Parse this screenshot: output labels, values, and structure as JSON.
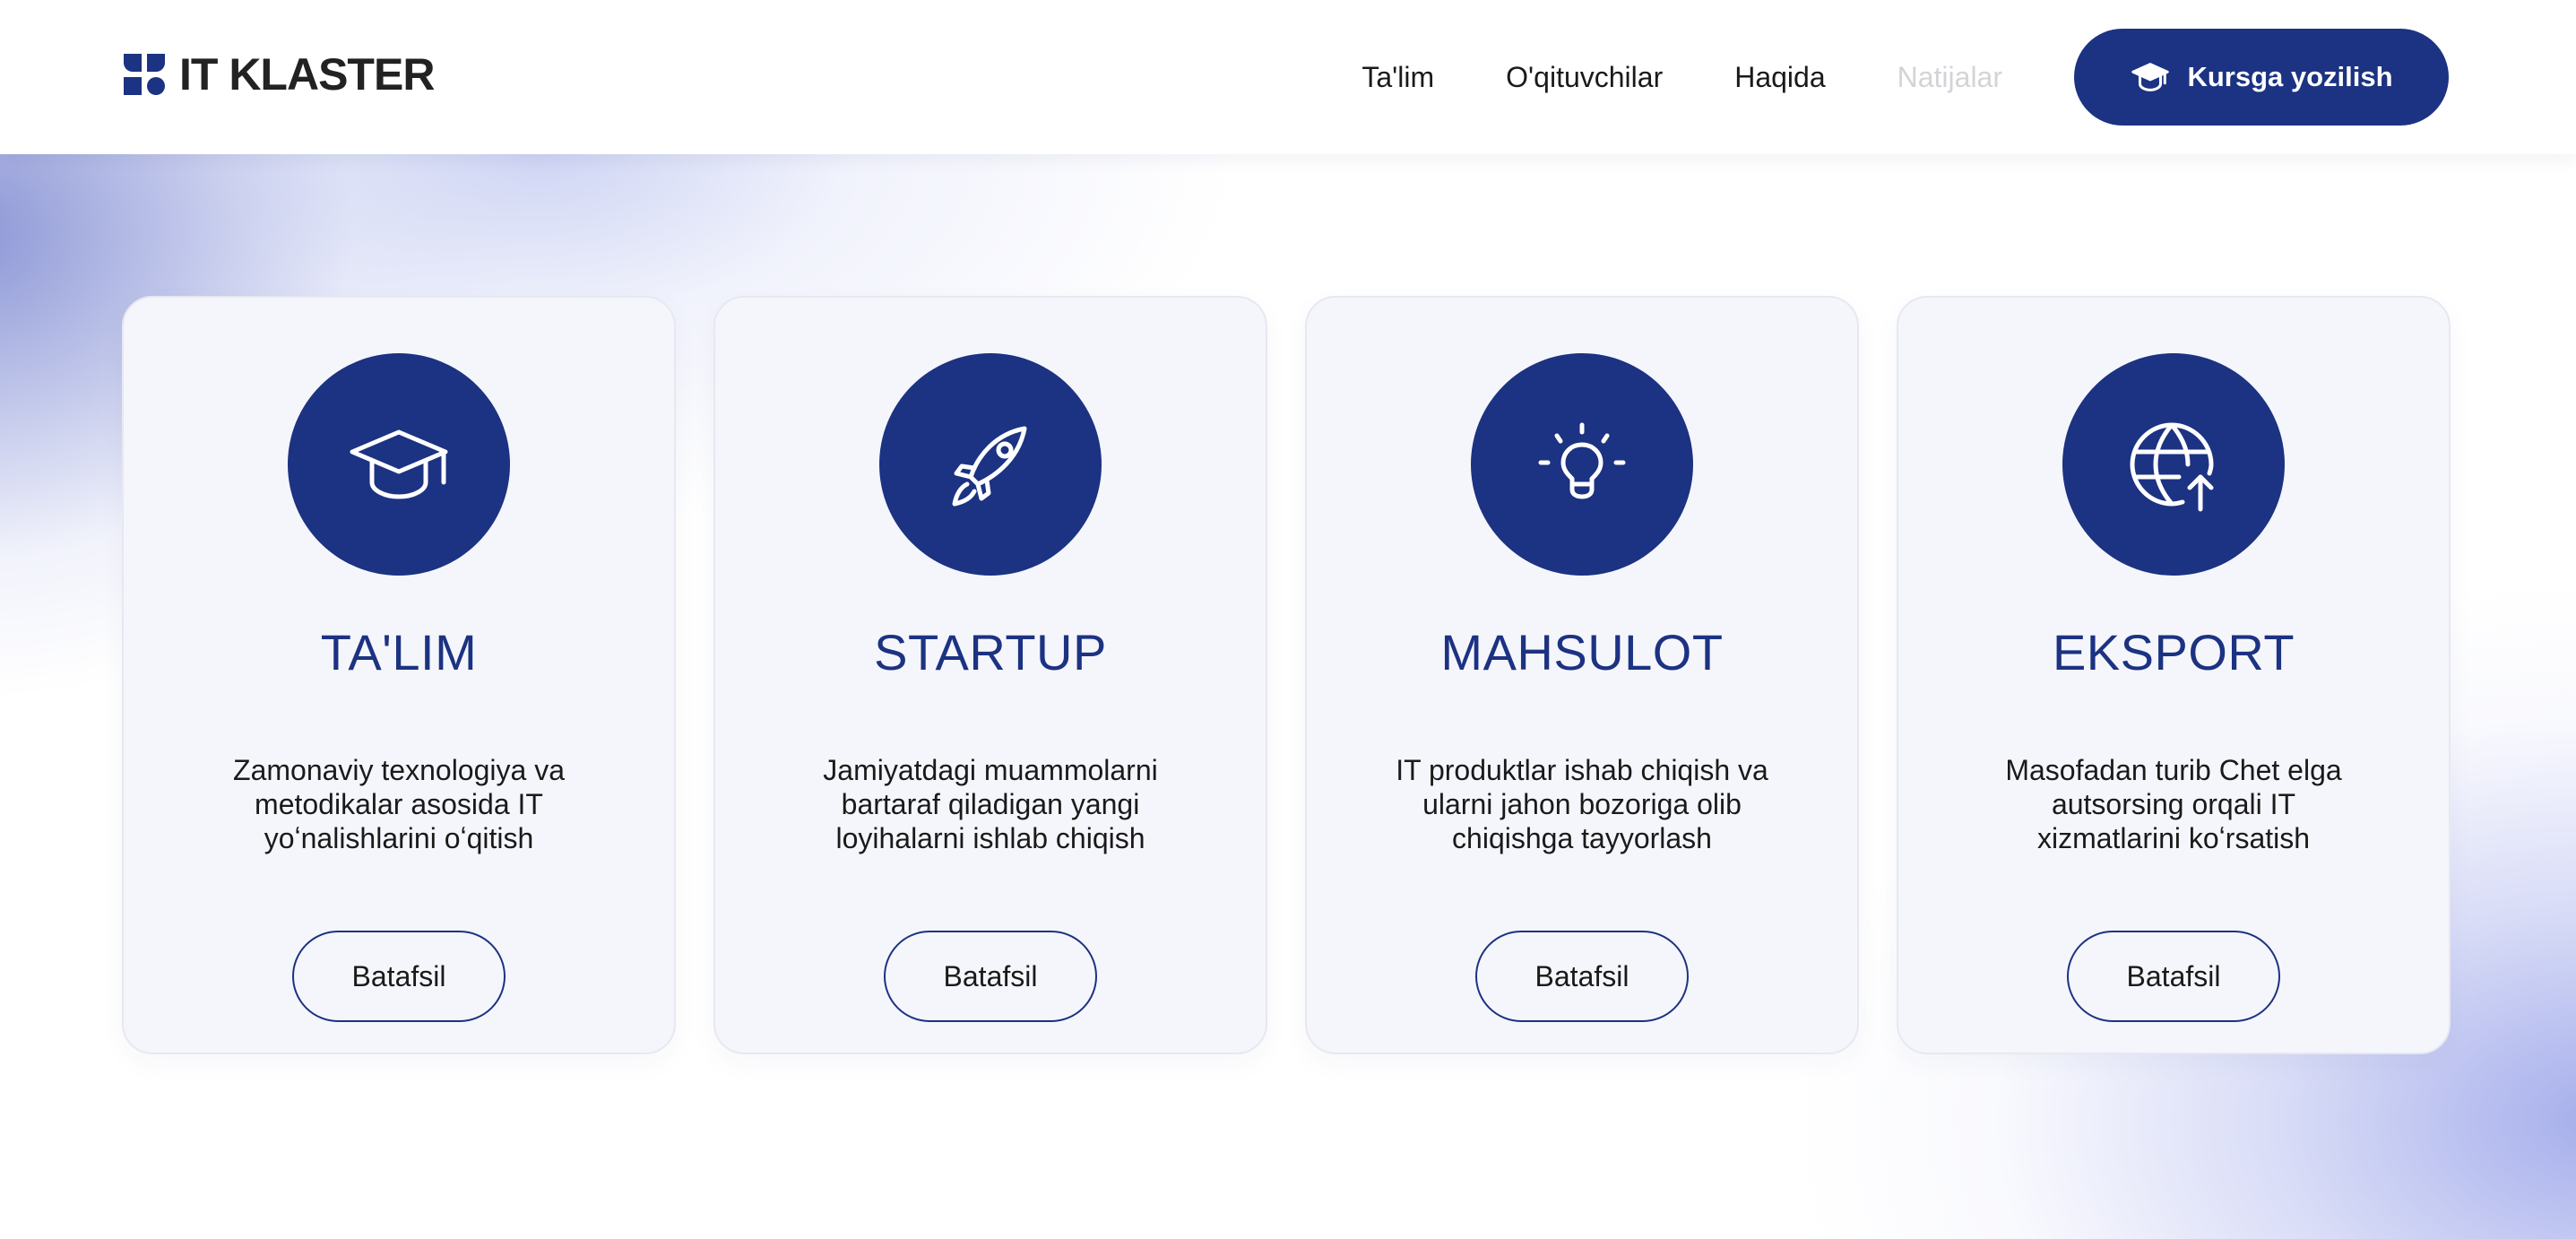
{
  "brand": {
    "name": "IT KLASTER",
    "accent_color": "#1c3282"
  },
  "header": {
    "nav": [
      {
        "label": "Ta'lim",
        "state": "normal"
      },
      {
        "label": "O'qituvchilar",
        "state": "normal"
      },
      {
        "label": "Haqida",
        "state": "normal"
      },
      {
        "label": "Natijalar",
        "state": "muted"
      }
    ],
    "cta": {
      "label": "Kursga yozilish",
      "icon": "graduation-cap-icon"
    }
  },
  "cards": [
    {
      "title": "TA'LIM",
      "icon": "graduation-cap-icon",
      "description": "Zamonaviy texnologiya va metodikalar asosida IT yoʻnalishlarini oʻqitish",
      "button": "Batafsil"
    },
    {
      "title": "STARTUP",
      "icon": "rocket-icon",
      "description": "Jamiyatdagi muammolarni bartaraf qiladigan yangi loyihalarni ishlab chiqish",
      "button": "Batafsil"
    },
    {
      "title": "MAHSULOT",
      "icon": "lightbulb-icon",
      "description": "IT produktlar ishab chiqish va ularni jahon bozoriga olib chiqishga tayyorlash",
      "button": "Batafsil"
    },
    {
      "title": "EKSPORT",
      "icon": "globe-upload-icon",
      "description": "Masofadan turib Chet elga autsorsing orqali IT xizmatlarini koʻrsatish",
      "button": "Batafsil"
    }
  ]
}
